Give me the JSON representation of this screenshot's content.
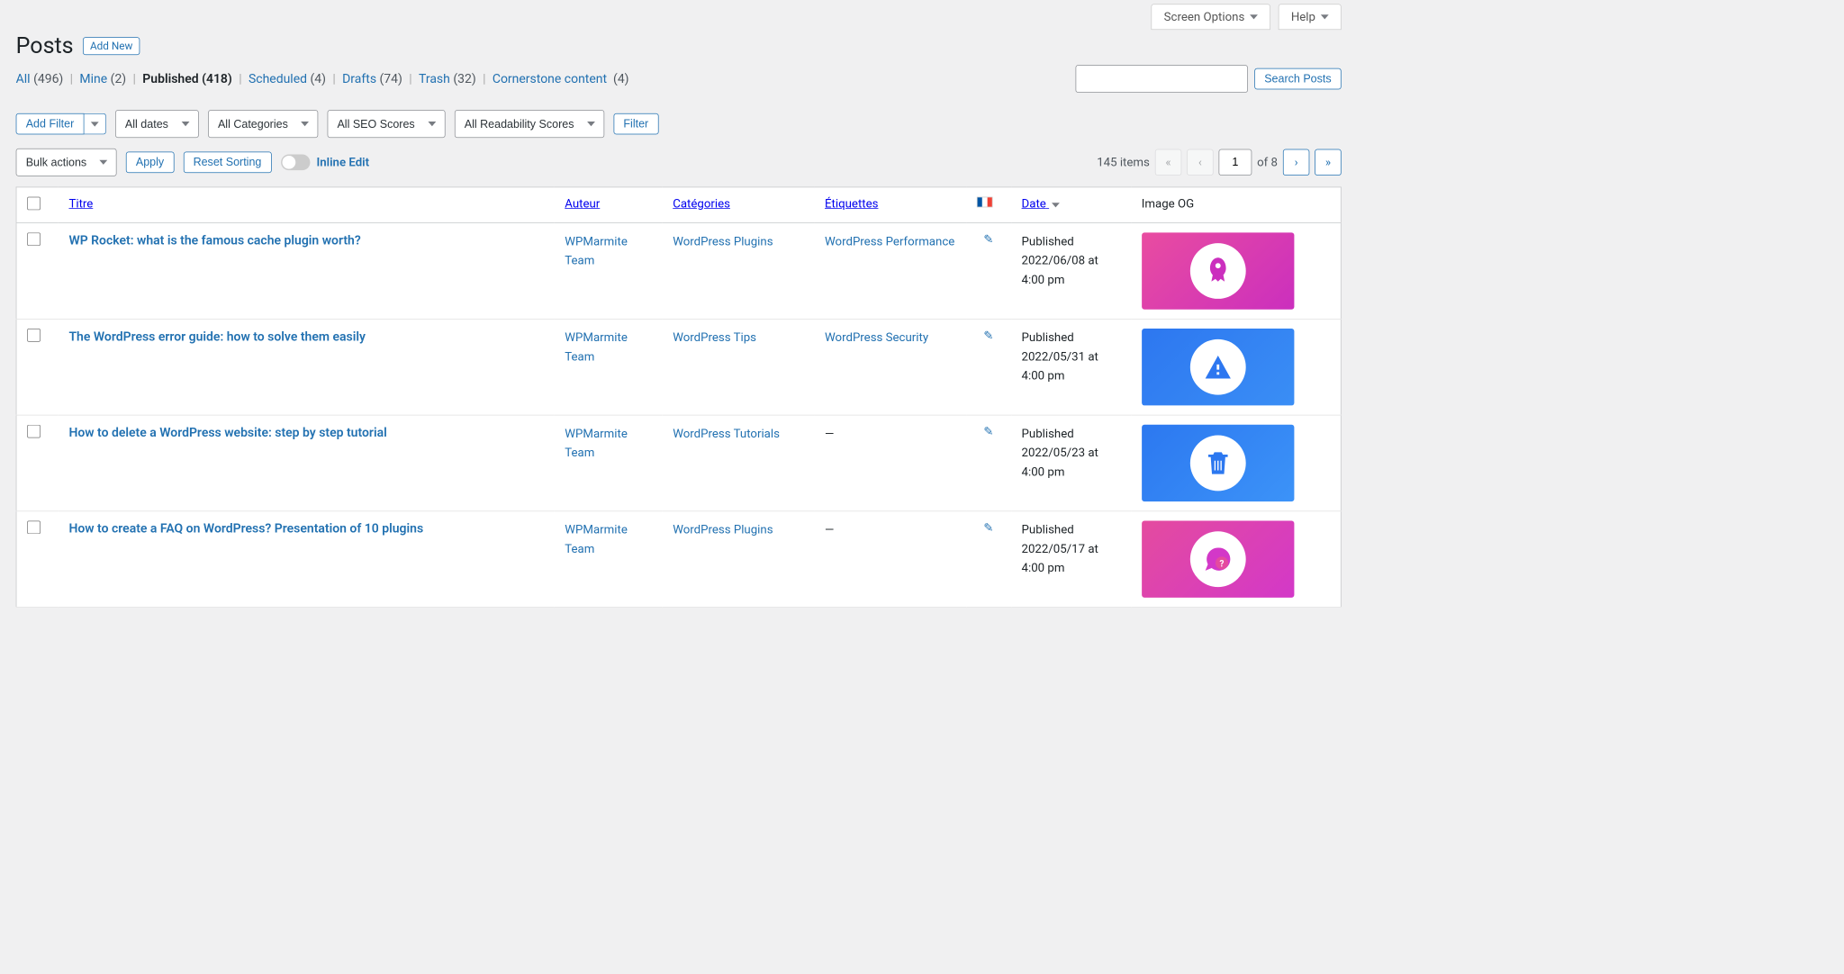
{
  "screen_options": "Screen Options",
  "help": "Help",
  "page_title": "Posts",
  "add_new": "Add New",
  "views": {
    "all_label": "All",
    "all_count": "(496)",
    "mine_label": "Mine",
    "mine_count": "(2)",
    "published_label": "Published",
    "published_count": "(418)",
    "scheduled_label": "Scheduled",
    "scheduled_count": "(4)",
    "drafts_label": "Drafts",
    "drafts_count": "(74)",
    "trash_label": "Trash",
    "trash_count": "(32)",
    "cornerstone_label": "Cornerstone content",
    "cornerstone_count": "(4)"
  },
  "search_button": "Search Posts",
  "add_filter": "Add Filter",
  "filter_dates": "All dates",
  "filter_categories": "All Categories",
  "filter_seo": "All SEO Scores",
  "filter_readability": "All Readability Scores",
  "filter_button": "Filter",
  "bulk_actions": "Bulk actions",
  "apply": "Apply",
  "reset_sorting": "Reset Sorting",
  "inline_edit": "Inline Edit",
  "items_count": "145 items",
  "page_current": "1",
  "page_total_label": "of 8",
  "columns": {
    "title": "Titre",
    "author": "Auteur",
    "categories": "Catégories",
    "tags": "Étiquettes",
    "date": "Date",
    "og": "Image OG"
  },
  "rows": [
    {
      "title": "WP Rocket: what is the famous cache plugin worth?",
      "author": "WPMarmite Team",
      "categories": "WordPress Plugins",
      "tags": "WordPress Performance",
      "status": "Published",
      "date": "2022/06/08 at 4:00 pm"
    },
    {
      "title": "The WordPress error guide: how to solve them easily",
      "author": "WPMarmite Team",
      "categories": "WordPress Tips",
      "tags": "WordPress Security",
      "status": "Published",
      "date": "2022/05/31 at 4:00 pm"
    },
    {
      "title": "How to delete a WordPress website: step by step tutorial",
      "author": "WPMarmite Team",
      "categories": "WordPress Tutorials",
      "tags": "—",
      "status": "Published",
      "date": "2022/05/23 at 4:00 pm"
    },
    {
      "title": "How to create a FAQ on WordPress? Presentation of 10 plugins",
      "author": "WPMarmite Team",
      "categories": "WordPress Plugins",
      "tags": "—",
      "status": "Published",
      "date": "2022/05/17 at 4:00 pm"
    }
  ]
}
